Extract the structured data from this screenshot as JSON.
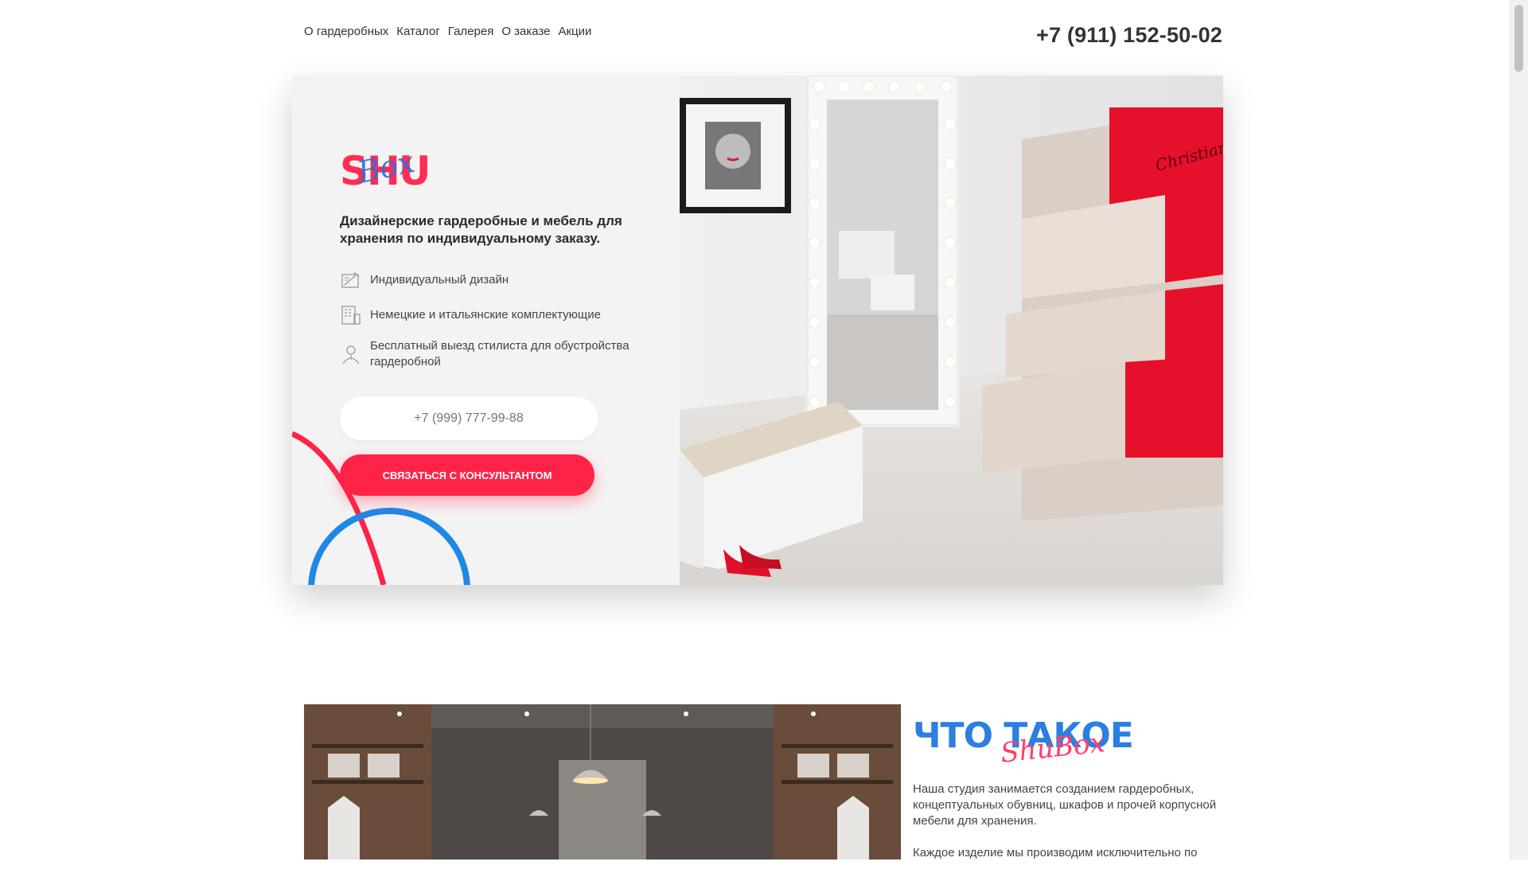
{
  "header": {
    "nav": [
      "О гардеробных",
      "Каталог",
      "Галерея",
      "О заказе",
      "Акции"
    ],
    "phone": "+7 (911) 152-50-02"
  },
  "hero": {
    "logo_main": "SHU",
    "logo_script": "Box",
    "tagline": "Дизайнерские гардеробные и мебель для хранения по индивидуальному заказу.",
    "features": [
      {
        "icon": "design-icon",
        "text": "Индивидуальный дизайн"
      },
      {
        "icon": "components-icon",
        "text": "Немецкие и итальянские комплектующие"
      },
      {
        "icon": "stylist-icon",
        "text": "Бесплатный выезд стилиста для обустройства гардеробной"
      }
    ],
    "phone_placeholder": "+7 (999) 777-99-88",
    "cta_label": "СВЯЗАТЬСЯ С КОНСУЛЬТАНТОМ",
    "photo_sign": "Christian Louboutin"
  },
  "about": {
    "title": "ЧТО ТАКОЕ",
    "title_script": "ShuBox",
    "paragraphs": [
      "Наша студия занимается созданием гардеробных, концептуальных обувниц, шкафов и прочей корпусной мебели для хранения.",
      "Каждое изделие мы производим исключительно по"
    ]
  },
  "colors": {
    "accent_red": "#ff2347",
    "accent_blue": "#2a7fe0"
  }
}
